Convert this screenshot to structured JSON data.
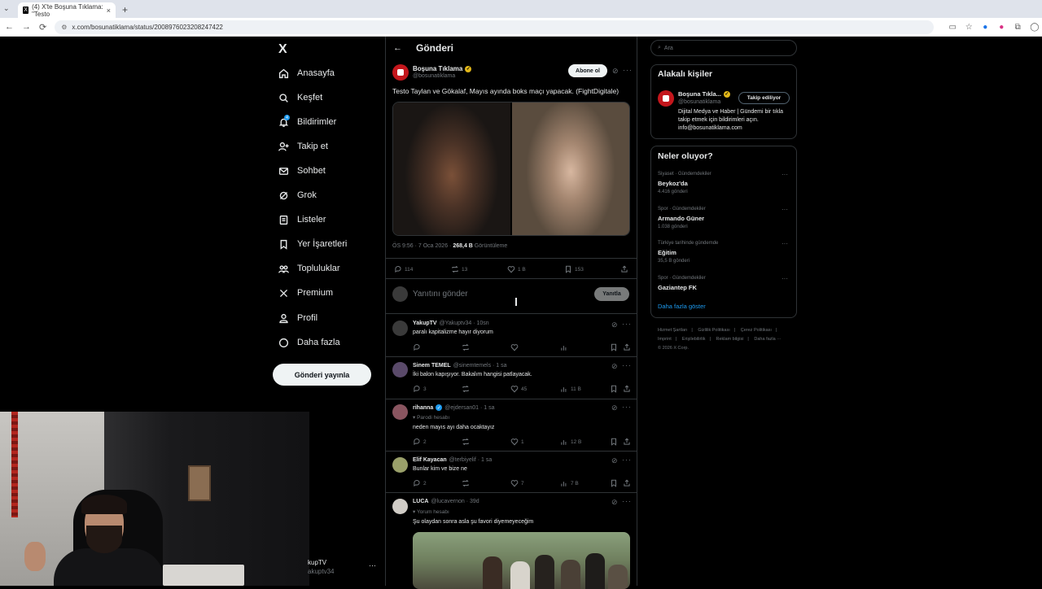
{
  "browser": {
    "tab_title": "(4) X'te Boşuna Tıklama: \"Testo",
    "tab_close": "×",
    "new_tab": "+",
    "url": "x.com/bosunatiklama/status/2008976023208247422"
  },
  "sidebar": {
    "logo": "X",
    "notif_count": "4",
    "items": [
      {
        "label": "Anasayfa"
      },
      {
        "label": "Keşfet"
      },
      {
        "label": "Bildirimler"
      },
      {
        "label": "Takip et"
      },
      {
        "label": "Sohbet"
      },
      {
        "label": "Grok"
      },
      {
        "label": "Listeler"
      },
      {
        "label": "Yer İşaretleri"
      },
      {
        "label": "Topluluklar"
      },
      {
        "label": "Premium"
      },
      {
        "label": "Profil"
      },
      {
        "label": "Daha fazla"
      }
    ],
    "post_button": "Gönderi yayınla",
    "account_name": "kupTV",
    "account_handle": "akuptv34",
    "account_more": "···"
  },
  "header": {
    "back": "←",
    "title": "Gönderi"
  },
  "post": {
    "name": "Boşuna Tıklama",
    "handle": "@bosunatiklama",
    "subscribe": "Abone ol",
    "text": "Testo Taylan ve Gökalaf, Mayıs ayında boks maçı yapacak. (FightDigitale)",
    "time": "ÖS 9:56 · 7 Oca 2026 · ",
    "views": "268,4 B",
    "views_label": " Görüntüleme",
    "replies": "114",
    "reposts": "13",
    "likes": "1 B",
    "bookmarks": "153"
  },
  "reply_box": {
    "placeholder": "Yanıtını gönder",
    "button": "Yanıtla"
  },
  "comments": [
    {
      "name": "YakupTV",
      "handle": "@Yakuptv34 · 10sn",
      "text": "paralı kapitalizme hayır diyorum",
      "replies": "",
      "likes": "",
      "views": ""
    },
    {
      "name": "Sinem TEMEL",
      "handle": "@sinemtemels · 1 sa",
      "text": "İki balon kapışıyor. Bakalım hangisi patlayacak.",
      "replies": "3",
      "likes": "45",
      "views": "11 B"
    },
    {
      "name": "rihanna",
      "handle": "@ejdersan01 · 1 sa",
      "badge": "Parodi hesabı",
      "text": "neden mayıs ayı daha ocaktayız",
      "replies": "2",
      "likes": "1",
      "views": "12 B"
    },
    {
      "name": "Elif Kayacan",
      "handle": "@terbiyelif · 1 sa",
      "text": "Bunlar kim ve bize ne",
      "replies": "2",
      "likes": "7",
      "views": "7 B"
    },
    {
      "name": "LUCA",
      "handle": "@lucavernon · 39d",
      "badge": "Yorum hesabı",
      "text": "Şu olaydan sonra asla şu favori diyemeyeceğim"
    }
  ],
  "right": {
    "search_placeholder": "Ara",
    "related_title": "Alakalı kişiler",
    "related_name": "Boşuna Tıkla...",
    "related_handle": "@bosunatiklama",
    "related_follow": "Takip ediliyor",
    "related_bio": "Dijital Medya ve Haber | Gündemi bir tıkla takip etmek için bildirimleri açın. info@bosunatiklama.com",
    "trends_title": "Neler oluyor?",
    "trends": [
      {
        "context": "Siyaset · Gündemdekiler",
        "title": "Beykoz'da",
        "count": "4.416 gönderi"
      },
      {
        "context": "Spor · Gündemdekiler",
        "title": "Armando Güner",
        "count": "1.038 gönderi"
      },
      {
        "context": "Türkiye tarihinde gündemde",
        "title": "Eğitim",
        "count": "35,5 B gönderi"
      },
      {
        "context": "Spor · Gündemdekiler",
        "title": "Gaziantep FK",
        "count": ""
      }
    ],
    "show_more": "Daha fazla göster",
    "footer": [
      "Hizmet Şartları",
      "|",
      "Gizlilik Politikası",
      "|",
      "Çerez Politikası",
      "|",
      "Imprint",
      "|",
      "Erişilebilirlik",
      "|",
      "Reklam bilgisi",
      "|",
      "Daha fazla ···",
      "© 2026 X Corp."
    ]
  }
}
